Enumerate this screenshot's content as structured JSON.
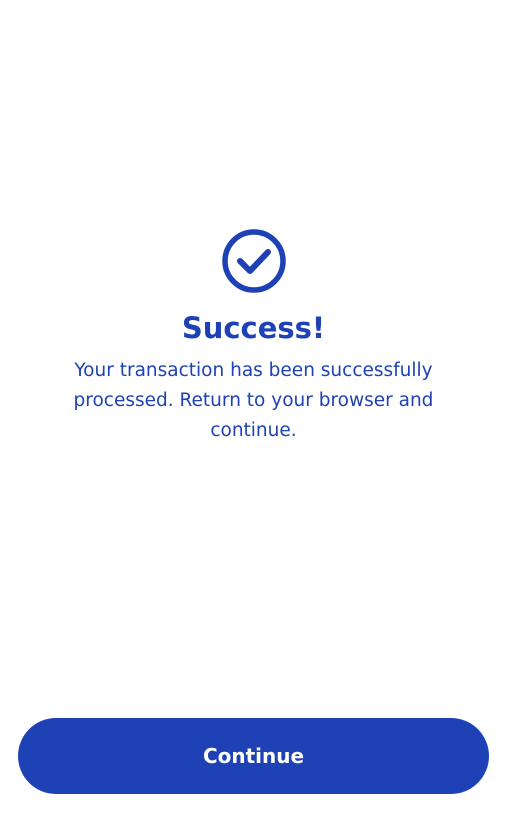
{
  "status": {
    "icon": "check-circle-icon",
    "title": "Success!",
    "message": "Your transaction has been successfully processed. Return to your browser and continue."
  },
  "actions": {
    "continue_label": "Continue"
  },
  "colors": {
    "accent": "#1e42b5",
    "background": "#ffffff",
    "button_text": "#ffffff"
  }
}
